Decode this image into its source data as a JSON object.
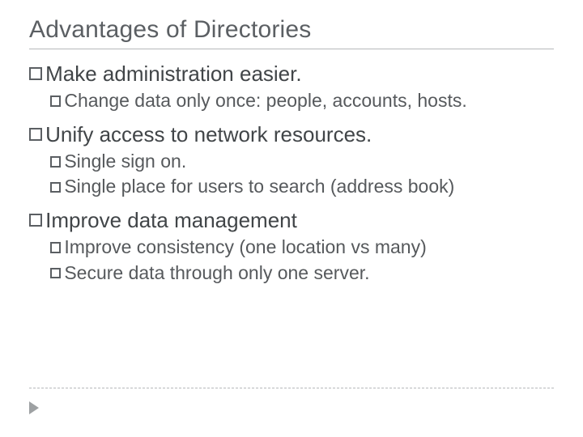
{
  "title": "Advantages of Directories",
  "bullets": [
    {
      "text": "Make administration easier.",
      "children": [
        {
          "text": "Change data only once: people, accounts, hosts."
        }
      ]
    },
    {
      "text": "Unify access to network resources.",
      "children": [
        {
          "text": "Single sign on."
        },
        {
          "text": "Single place for users to search (address book)"
        }
      ]
    },
    {
      "text": "Improve data management",
      "children": [
        {
          "text": "Improve consistency (one location vs many)"
        },
        {
          "text": "Secure data through only one server."
        }
      ]
    }
  ]
}
